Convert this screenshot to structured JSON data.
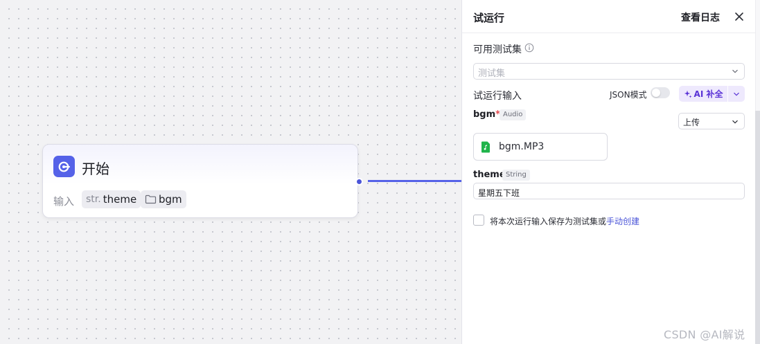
{
  "canvas": {
    "start_node": {
      "title": "开始",
      "input_label": "输入",
      "params": [
        {
          "type_prefix": "str.",
          "name": "theme"
        },
        {
          "type_prefix": "",
          "name": "bgm"
        }
      ]
    }
  },
  "panel": {
    "title": "试运行",
    "view_log": "查看日志",
    "testset": {
      "label": "可用测试集",
      "placeholder": "测试集"
    },
    "run_input": {
      "label": "试运行输入",
      "json_mode_label": "JSON模式",
      "json_mode_on": false,
      "ai_fill_label": "AI 补全"
    },
    "bgm": {
      "name": "bgm",
      "required_mark": "*",
      "type": "Audio",
      "source_option": "上传",
      "file_name": "bgm.MP3"
    },
    "theme": {
      "name": "theme",
      "type": "String",
      "value": "星期五下班"
    },
    "save": {
      "text": "将本次运行输入保存为测试集或",
      "link": "手动创建",
      "checked": false
    }
  },
  "watermark": "CSDN @AI解说",
  "colors": {
    "accent": "#5562e8",
    "ai_purple": "#5a33d6",
    "file_green": "#1fb44a",
    "required_red": "#e5484d"
  }
}
